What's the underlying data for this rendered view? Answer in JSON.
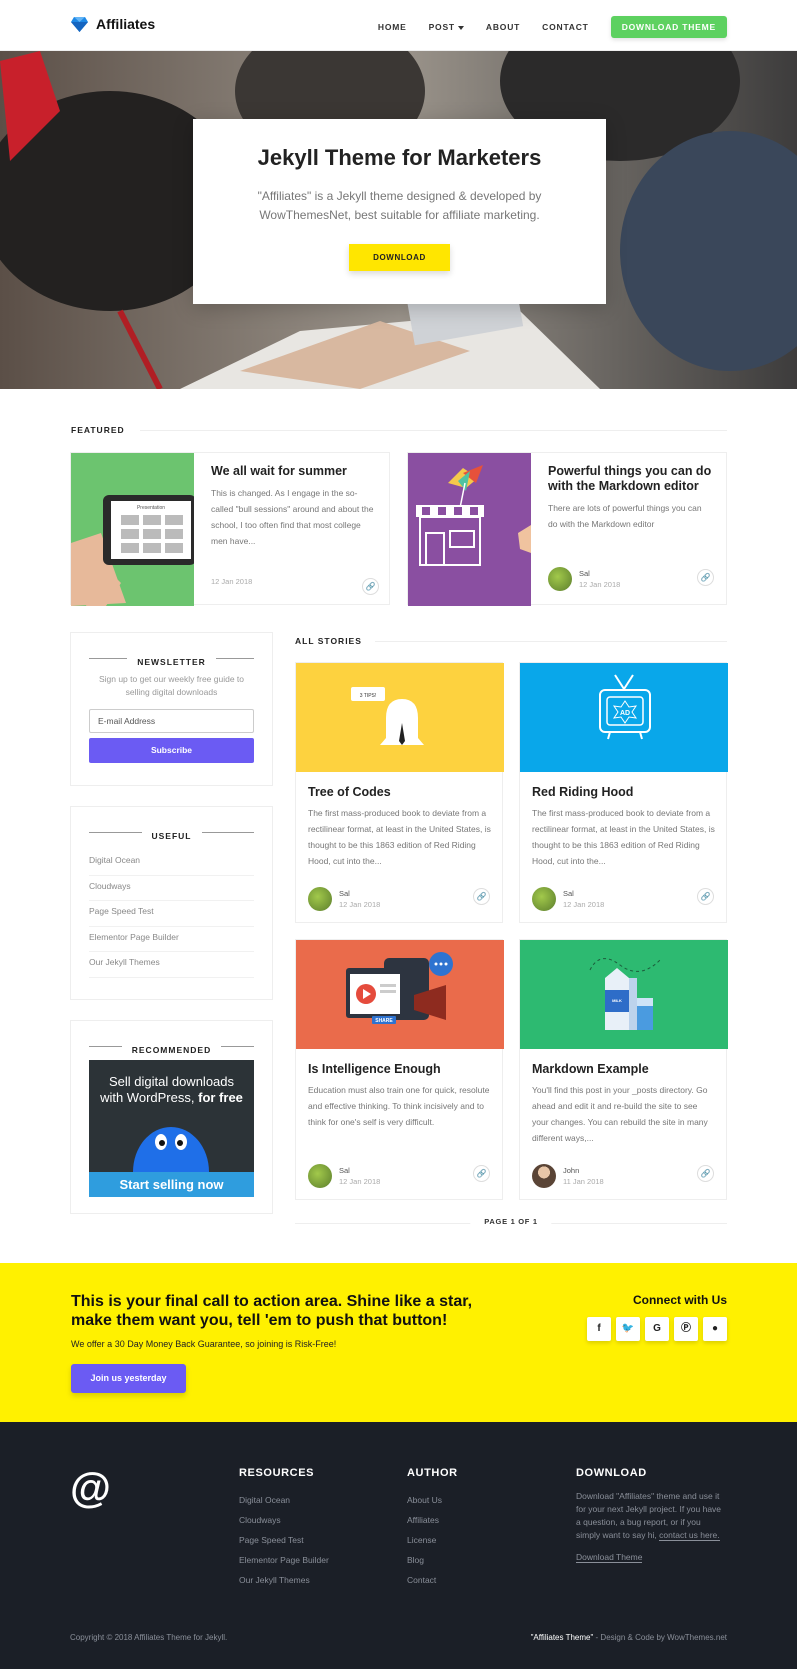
{
  "brand": {
    "name": "Affiliates"
  },
  "nav": {
    "home": "HOME",
    "post": "POST",
    "about": "ABOUT",
    "contact": "CONTACT",
    "cta": "DOWNLOAD THEME"
  },
  "hero": {
    "title": "Jekyll Theme for Marketers",
    "subtitle": "\"Affiliates\" is a Jekyll theme designed & developed by WowThemesNet, best suitable for affiliate marketing.",
    "button": "DOWNLOAD"
  },
  "featured": {
    "heading": "FEATURED",
    "posts": [
      {
        "title": "We all wait for summer",
        "excerpt": "This is changed. As I engage in the so-called \"bull sessions\" around and about the school, I too often find that most college men have...",
        "date": "12 Jan 2018"
      },
      {
        "title": "Powerful things you can do with the Markdown editor",
        "excerpt": "There are lots of powerful things you can do with the Markdown editor",
        "author": "Sal",
        "date": "12 Jan 2018",
        "illustration_text": "Presentation"
      }
    ]
  },
  "sidebar": {
    "newsletter": {
      "title": "NEWSLETTER",
      "text": "Sign up to get our weekly free guide to selling digital downloads",
      "placeholder": "E-mail Address",
      "button": "Subscribe"
    },
    "useful": {
      "title": "USEFUL",
      "links": [
        "Digital Ocean",
        "Cloudways",
        "Page Speed Test",
        "Elementor Page Builder",
        "Our Jekyll Themes"
      ]
    },
    "recommended": {
      "title": "RECOMMENDED",
      "ad_line1": "Sell digital downloads",
      "ad_line2": "with WordPress,",
      "ad_bold": "for free",
      "ad_button": "Start selling now"
    }
  },
  "stories": {
    "heading": "ALL STORIES",
    "posts": [
      {
        "title": "Tree of Codes",
        "excerpt": "The first mass-produced book to deviate from a rectilinear format, at least in the United States, is thought to be this 1863 edition of Red Riding Hood, cut into the...",
        "author": "Sal",
        "date": "12 Jan 2018",
        "color": "#fdd23f"
      },
      {
        "title": "Red Riding Hood",
        "excerpt": "The first mass-produced book to deviate from a rectilinear format, at least in the United States, is thought to be this 1863 edition of Red Riding Hood, cut into the...",
        "author": "Sal",
        "date": "12 Jan 2018",
        "color": "#09a7ea"
      },
      {
        "title": "Is Intelligence Enough",
        "excerpt": "Education must also train one for quick, resolute and effective thinking. To think incisively and to think for one's self is very difficult.",
        "author": "Sal",
        "date": "12 Jan 2018",
        "color": "#ea6b4b"
      },
      {
        "title": "Markdown Example",
        "excerpt": "You'll find this post in your _posts directory. Go ahead and edit it and re-build the site to see your changes. You can rebuild the site in many different ways,...",
        "author": "John",
        "date": "11 Jan 2018",
        "color": "#2dba71"
      }
    ],
    "pager": "PAGE 1 OF 1",
    "thumb_labels": {
      "snap": "3 TIPS!",
      "tv": "AD",
      "share": "SHARE",
      "milk": "MILK"
    }
  },
  "cta": {
    "headline": "This is your final call to action area. Shine like a star, make them want you, tell 'em to push that button!",
    "sub": "We offer a 30 Day Money Back Guarantee, so joining is Risk-Free!",
    "button": "Join us yesterday",
    "connect": "Connect with Us",
    "socials": [
      "f",
      "t",
      "G",
      "p",
      "gh"
    ]
  },
  "footer": {
    "logo": "@",
    "resources": {
      "title": "RESOURCES",
      "links": [
        "Digital Ocean",
        "Cloudways",
        "Page Speed Test",
        "Elementor Page Builder",
        "Our Jekyll Themes"
      ]
    },
    "author": {
      "title": "AUTHOR",
      "links": [
        "About Us",
        "Affiliates",
        "License",
        "Blog",
        "Contact"
      ]
    },
    "download": {
      "title": "DOWNLOAD",
      "text": "Download \"Affiliates\" theme and use it for your next Jekyll project. If you have a question, a bug report, or if you simply want to say hi,",
      "contact": "contact us here.",
      "link": "Download Theme"
    },
    "copyright": "Copyright © 2018 Affiliates Theme for Jekyll.",
    "credit_theme": "\"Affiliates Theme\"",
    "credit_rest": " - Design & Code by WowThemes.net"
  }
}
